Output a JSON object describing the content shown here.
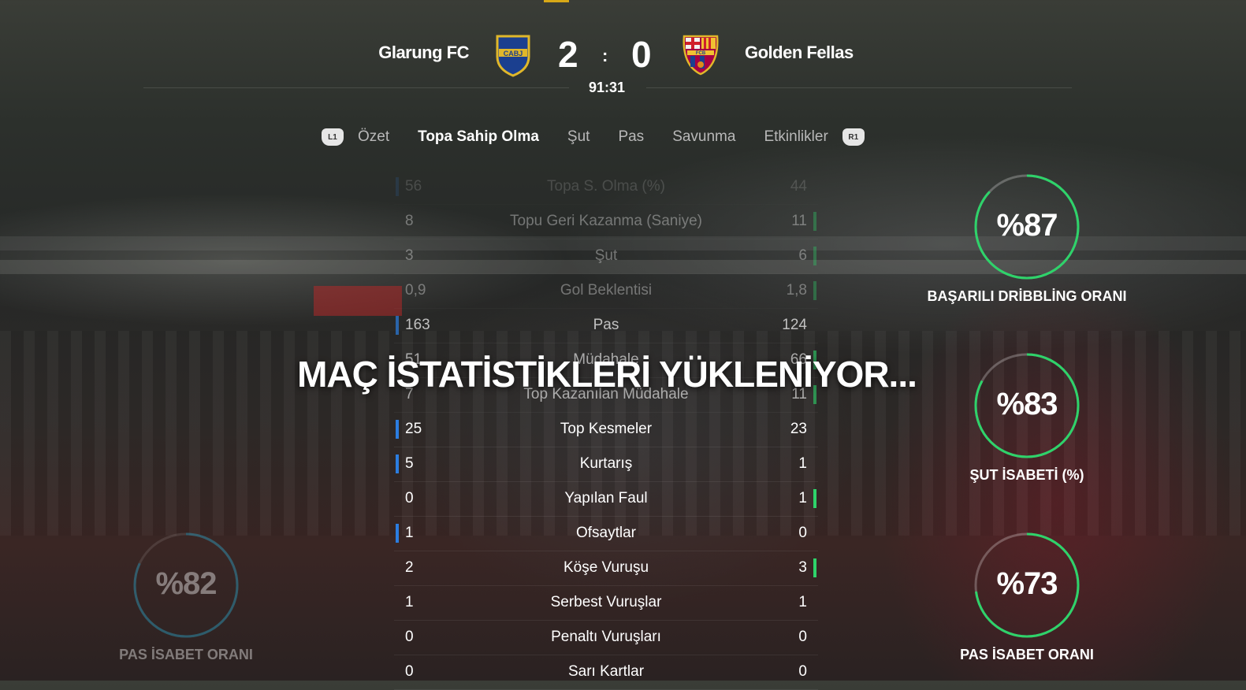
{
  "scoreboard": {
    "home": {
      "name": "Glarung FC",
      "crest_text": "CABJ",
      "score": "2"
    },
    "away": {
      "name": "Golden Fellas",
      "crest_text": "FCB",
      "score": "0"
    },
    "separator": ":",
    "clock": "91:31"
  },
  "tabs": {
    "left_button": "L1",
    "right_button": "R1",
    "items": [
      "Özet",
      "Topa Sahip Olma",
      "Şut",
      "Pas",
      "Savunma",
      "Etkinlikler"
    ],
    "active": "Topa Sahip Olma"
  },
  "stats": [
    {
      "label": "Topa S. Olma (%)",
      "home": "56",
      "away": "44"
    },
    {
      "label": "Topu Geri Kazanma (Saniye)",
      "home": "8",
      "away": "11"
    },
    {
      "label": "Şut",
      "home": "3",
      "away": "6"
    },
    {
      "label": "Gol Beklentisi",
      "home": "0,9",
      "away": "1,8"
    },
    {
      "label": "Pas",
      "home": "163",
      "away": "124"
    },
    {
      "label": "Müdahale",
      "home": "51",
      "away": "66"
    },
    {
      "label": "Top Kazanılan Müdahale",
      "home": "7",
      "away": "11"
    },
    {
      "label": "Top Kesmeler",
      "home": "25",
      "away": "23"
    },
    {
      "label": "Kurtarış",
      "home": "5",
      "away": "1"
    },
    {
      "label": "Yapılan Faul",
      "home": "0",
      "away": "1"
    },
    {
      "label": "Ofsaytlar",
      "home": "1",
      "away": "0"
    },
    {
      "label": "Köşe Vuruşu",
      "home": "2",
      "away": "3"
    },
    {
      "label": "Serbest Vuruşlar",
      "home": "1",
      "away": "1"
    },
    {
      "label": "Penaltı Vuruşları",
      "home": "0",
      "away": "0"
    },
    {
      "label": "Sarı Kartlar",
      "home": "0",
      "away": "0"
    }
  ],
  "loading_text": "MAÇ İSTATİSTİKLERİ YÜKLENİYOR...",
  "rings": {
    "dribbling": {
      "value": "%87",
      "label": "BAŞARILI DRİBBLİNG ORANI",
      "fraction": 0.87
    },
    "shot": {
      "value": "%83",
      "label": "ŞUT İSABETİ (%)",
      "fraction": 0.83
    },
    "pass_away": {
      "value": "%73",
      "label": "PAS İSABET ORANI",
      "fraction": 0.73
    },
    "pass_home": {
      "value": "%82",
      "label": "PAS İSABET ORANI",
      "fraction": 0.82
    }
  },
  "colors": {
    "home_bar": "#2b7de0",
    "away_bar": "#2ed36a"
  }
}
